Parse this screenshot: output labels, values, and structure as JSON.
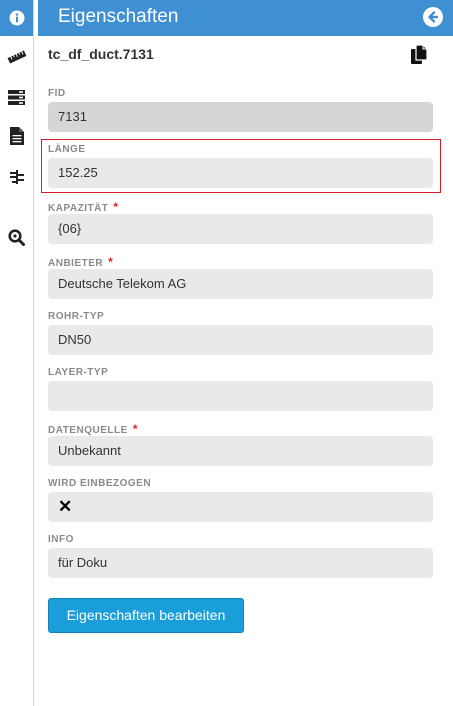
{
  "panel": {
    "title": "Eigenschaften",
    "object_id": "tc_df_duct.7131"
  },
  "fields": {
    "fid": {
      "label": "FID",
      "value": "7131"
    },
    "laenge": {
      "label": "LÄNGE",
      "value": "152.25"
    },
    "kapazitaet": {
      "label": "KAPAZITÄT",
      "required_mark": "*",
      "value": "{06}"
    },
    "anbieter": {
      "label": "ANBIETER",
      "required_mark": "*",
      "value": "Deutsche Telekom AG"
    },
    "rohr_typ": {
      "label": "ROHR-TYP",
      "value": "DN50"
    },
    "layer_typ": {
      "label": "LAYER-TYP",
      "value": ""
    },
    "datenquelle": {
      "label": "DATENQUELLE",
      "required_mark": "*",
      "value": "Unbekannt"
    },
    "wird_einbezogen": {
      "label": "WIRD EINBEZOGEN",
      "value": "✕"
    },
    "info": {
      "label": "INFO",
      "value": "für Doku"
    }
  },
  "actions": {
    "edit_label": "Eigenschaften bearbeiten"
  },
  "icons": {
    "sidebar": [
      "info-icon",
      "ruler-icon",
      "layers-icon",
      "document-icon",
      "network-icon",
      "zoom-icon"
    ],
    "header": "arrow-left-circle-icon",
    "copy": "copy-icon"
  },
  "colors": {
    "header": "#3f8fd3",
    "button": "#1a9ed9",
    "required": "#dd2222",
    "highlight": "#d21e2c"
  }
}
